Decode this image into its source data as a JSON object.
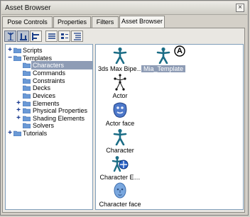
{
  "window": {
    "title": "Asset Browser",
    "close_glyph": "×"
  },
  "tabs": [
    {
      "label": "Pose Controls",
      "active": false
    },
    {
      "label": "Properties",
      "active": false
    },
    {
      "label": "Filters",
      "active": false
    },
    {
      "label": "Asset Browser",
      "active": true
    }
  ],
  "toolbar": {
    "buttons": [
      {
        "icon": "tree-view-icon",
        "active": true
      },
      {
        "icon": "split-view-icon",
        "active": true
      },
      {
        "icon": "horizontal-split-icon",
        "active": false
      },
      {
        "icon": "list-view-icon",
        "active": false
      },
      {
        "icon": "thumbnail-view-icon",
        "active": false
      },
      {
        "icon": "detail-view-icon",
        "active": false
      }
    ]
  },
  "tree": {
    "items": [
      {
        "label": "Scripts",
        "level": 0,
        "expander": "+",
        "selected": false
      },
      {
        "label": "Templates",
        "level": 0,
        "expander": "−",
        "selected": false
      },
      {
        "label": "Characters",
        "level": 1,
        "expander": "",
        "selected": true
      },
      {
        "label": "Commands",
        "level": 1,
        "expander": "",
        "selected": false
      },
      {
        "label": "Constraints",
        "level": 1,
        "expander": "",
        "selected": false
      },
      {
        "label": "Decks",
        "level": 1,
        "expander": "",
        "selected": false
      },
      {
        "label": "Devices",
        "level": 1,
        "expander": "",
        "selected": false
      },
      {
        "label": "Elements",
        "level": 1,
        "expander": "+",
        "selected": false
      },
      {
        "label": "Physical Properties",
        "level": 1,
        "expander": "+",
        "selected": false
      },
      {
        "label": "Shading Elements",
        "level": 1,
        "expander": "+",
        "selected": false
      },
      {
        "label": "Solvers",
        "level": 1,
        "expander": "",
        "selected": false
      },
      {
        "label": "Tutorials",
        "level": 0,
        "expander": "+",
        "selected": false
      }
    ]
  },
  "gallery": {
    "items": [
      {
        "label": "3ds Max Bipe…",
        "icon": "character-figure-icon",
        "selected": false
      },
      {
        "label": "Mia_Template",
        "icon": "character-figure-icon",
        "selected": true
      },
      {
        "label": "Actor",
        "icon": "actor-skeleton-icon",
        "selected": false
      },
      {
        "label": "Actor face",
        "icon": "actor-face-icon",
        "selected": false
      },
      {
        "label": "Character",
        "icon": "character-figure-icon",
        "selected": false
      },
      {
        "label": "Character E…",
        "icon": "character-extension-icon",
        "selected": false
      },
      {
        "label": "Character face",
        "icon": "character-face-icon",
        "selected": false
      }
    ]
  },
  "annotation": {
    "text": "A"
  },
  "colors": {
    "accent": "#8e9cb5",
    "folder": "#6b9ad6",
    "figure": "#1b6d86"
  }
}
